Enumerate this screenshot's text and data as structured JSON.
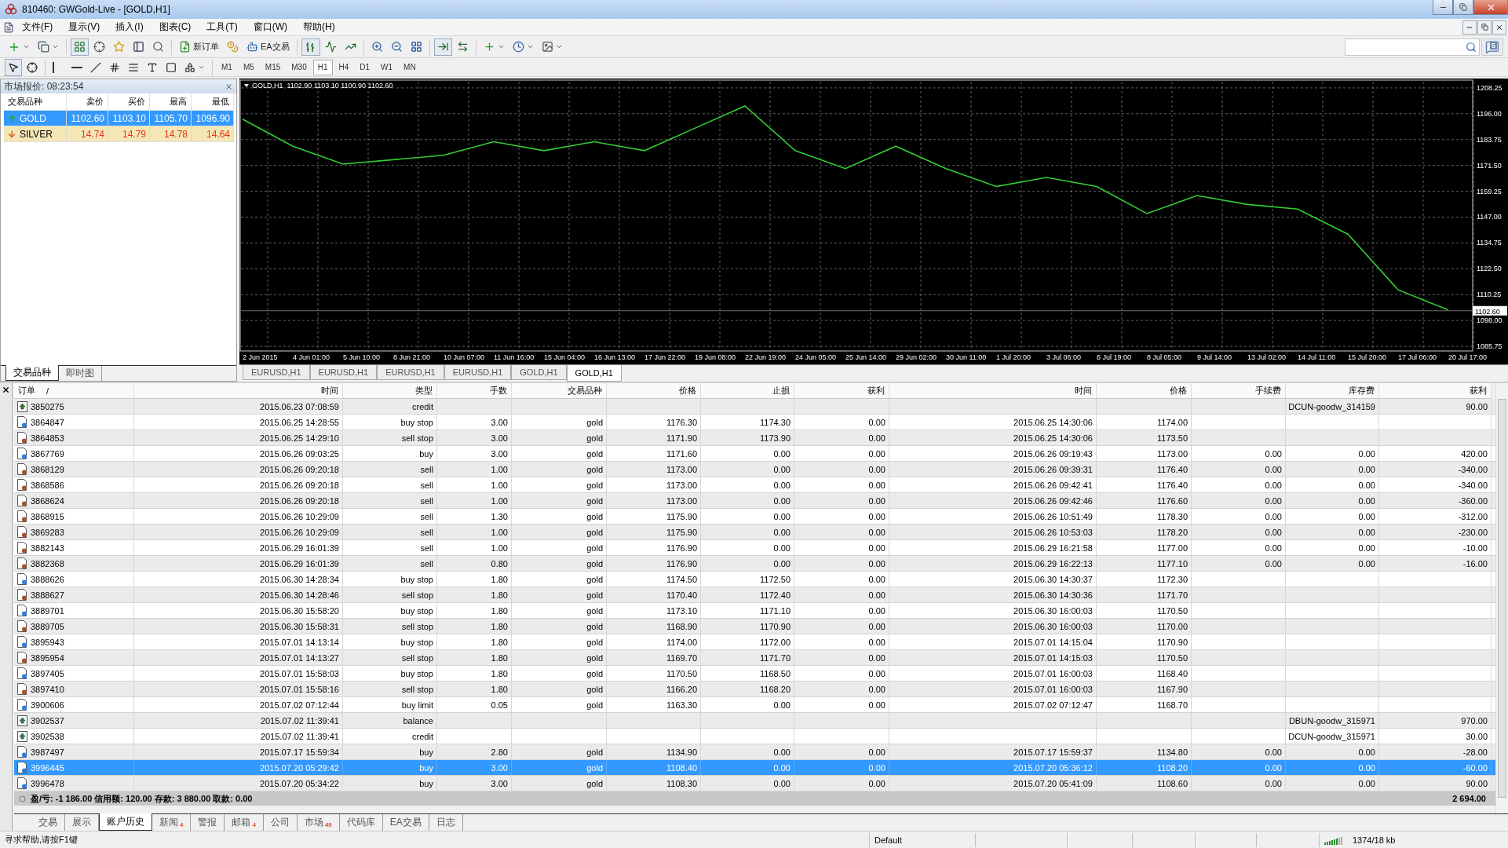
{
  "window": {
    "title": "810460: GWGold-Live - [GOLD,H1]"
  },
  "menu": [
    "文件(F)",
    "显示(V)",
    "插入(I)",
    "图表(C)",
    "工具(T)",
    "窗口(W)",
    "帮助(H)"
  ],
  "toolbar": {
    "buttons": [
      "新订单",
      "EA交易"
    ],
    "notifications": "5"
  },
  "timeframes": [
    {
      "label": "M1",
      "selected": false
    },
    {
      "label": "M5",
      "selected": false
    },
    {
      "label": "M15",
      "selected": false
    },
    {
      "label": "M30",
      "selected": false
    },
    {
      "label": "H1",
      "selected": true
    },
    {
      "label": "H4",
      "selected": false
    },
    {
      "label": "D1",
      "selected": false
    },
    {
      "label": "W1",
      "selected": false
    },
    {
      "label": "MN",
      "selected": false
    }
  ],
  "market_watch": {
    "title": "市场报价: 08:23:54",
    "columns": [
      "交易品种",
      "卖价",
      "买价",
      "最高",
      "最低"
    ],
    "rows": [
      {
        "symbol": "GOLD",
        "rising": true,
        "selected": true,
        "bid": "1102.60",
        "ask": "1103.10",
        "high": "1105.70",
        "low": "1096.90"
      },
      {
        "symbol": "SILVER",
        "rising": false,
        "selected": false,
        "bid": "14.74",
        "ask": "14.79",
        "high": "14.78",
        "low": "14.64"
      }
    ],
    "tabs": [
      {
        "label": "交易品种",
        "selected": true
      },
      {
        "label": "即时图",
        "selected": false
      }
    ]
  },
  "chart": {
    "header": "GOLD,H1  1102.90 1103.10 1100.90 1102.60",
    "chart_data": {
      "type": "line",
      "x": [
        "2 Jun 2015",
        "4 Jun 01:00",
        "5 Jun 10:00",
        "8 Jun 21:00",
        "10 Jun 07:00",
        "11 Jun 16:00",
        "15 Jun 04:00",
        "16 Jun 13:00",
        "17 Jun 22:00",
        "19 Jun 08:00",
        "22 Jun 19:00",
        "24 Jun 05:00",
        "25 Jun 14:00",
        "29 Jun 02:00",
        "30 Jun 11:00",
        "1 Jul 20:00",
        "3 Jul 06:00",
        "6 Jul 19:00",
        "8 Jul 05:00",
        "9 Jul 14:00",
        "13 Jul 02:00",
        "14 Jul 11:00",
        "15 Jul 20:00",
        "17 Jul 06:00",
        "20 Jul 17:00"
      ],
      "series": [
        {
          "color": "#33cc33",
          "values": [
            1193.4,
            1180.6,
            1172.1,
            1174.2,
            1176.3,
            1182.7,
            1178.5,
            1182.7,
            1178.5,
            1189.1,
            1199.7,
            1178.5,
            1170.0,
            1180.6,
            1170.0,
            1161.5,
            1165.8,
            1161.5,
            1148.7,
            1157.2,
            1153.0,
            1150.8,
            1138.9,
            1112.5,
            1103.0
          ]
        }
      ],
      "yticks": [
        {
          "value": 1208.25,
          "label": "1208.25"
        },
        {
          "value": 1196,
          "label": "1196.00"
        },
        {
          "value": 1183.75,
          "label": "1183.75"
        },
        {
          "value": 1171.5,
          "label": "1171.50"
        },
        {
          "value": 1159.25,
          "label": "1159.25"
        },
        {
          "value": 1147,
          "label": "1147.00"
        },
        {
          "value": 1134.75,
          "label": "1134.75"
        },
        {
          "value": 1122.5,
          "label": "1122.50"
        },
        {
          "value": 1110.25,
          "label": "1110.25"
        },
        {
          "value": 1098,
          "label": "1098.00"
        },
        {
          "value": 1085.75,
          "label": "1085.75"
        }
      ],
      "ylim": [
        1083.9,
        1211.2
      ],
      "grid": true,
      "ref_lines": [
        {
          "axis": "y",
          "value": 1102.6,
          "label": "1102.60"
        }
      ]
    },
    "tabs": [
      {
        "label": "EURUSD,H1",
        "selected": false
      },
      {
        "label": "EURUSD,H1",
        "selected": false
      },
      {
        "label": "EURUSD,H1",
        "selected": false
      },
      {
        "label": "EURUSD,H1",
        "selected": false
      },
      {
        "label": "GOLD,H1",
        "selected": false
      },
      {
        "label": "GOLD,H1",
        "selected": true
      }
    ]
  },
  "history": {
    "columns": [
      "订单",
      "时间",
      "类型",
      "手数",
      "交易品种",
      "价格",
      "止损",
      "获利",
      "时间",
      "价格",
      "手续费",
      "库存费",
      "获利"
    ],
    "sort_mark": "/",
    "rows": [
      {
        "kind": "deposit",
        "selected": false,
        "order": "3850275",
        "time": "2015.06.23 07:08:59",
        "type": "credit",
        "comment": "DCUN-goodw_314159",
        "profit": "90.00"
      },
      {
        "kind": "buy",
        "selected": false,
        "order": "3864847",
        "time": "2015.06.25 14:28:55",
        "type": "buy stop",
        "lots": "3.00",
        "symbol": "gold",
        "price": "1176.30",
        "sl": "1174.30",
        "tp": "0.00",
        "close_time": "2015.06.25 14:30:06",
        "close_price": "1174.00"
      },
      {
        "kind": "sell",
        "selected": false,
        "order": "3864853",
        "time": "2015.06.25 14:29:10",
        "type": "sell stop",
        "lots": "3.00",
        "symbol": "gold",
        "price": "1171.90",
        "sl": "1173.90",
        "tp": "0.00",
        "close_time": "2015.06.25 14:30:06",
        "close_price": "1173.50"
      },
      {
        "kind": "buy",
        "selected": false,
        "order": "3867769",
        "time": "2015.06.26 09:03:25",
        "type": "buy",
        "lots": "3.00",
        "symbol": "gold",
        "price": "1171.60",
        "sl": "0.00",
        "tp": "0.00",
        "close_time": "2015.06.26 09:19:43",
        "close_price": "1173.00",
        "commission": "0.00",
        "swap": "0.00",
        "profit": "420.00"
      },
      {
        "kind": "sell",
        "selected": false,
        "order": "3868129",
        "time": "2015.06.26 09:20:18",
        "type": "sell",
        "lots": "1.00",
        "symbol": "gold",
        "price": "1173.00",
        "sl": "0.00",
        "tp": "0.00",
        "close_time": "2015.06.26 09:39:31",
        "close_price": "1176.40",
        "commission": "0.00",
        "swap": "0.00",
        "profit": "-340.00"
      },
      {
        "kind": "sell",
        "selected": false,
        "order": "3868586",
        "time": "2015.06.26 09:20:18",
        "type": "sell",
        "lots": "1.00",
        "symbol": "gold",
        "price": "1173.00",
        "sl": "0.00",
        "tp": "0.00",
        "close_time": "2015.06.26 09:42:41",
        "close_price": "1176.40",
        "commission": "0.00",
        "swap": "0.00",
        "profit": "-340.00"
      },
      {
        "kind": "sell",
        "selected": false,
        "order": "3868624",
        "time": "2015.06.26 09:20:18",
        "type": "sell",
        "lots": "1.00",
        "symbol": "gold",
        "price": "1173.00",
        "sl": "0.00",
        "tp": "0.00",
        "close_time": "2015.06.26 09:42:46",
        "close_price": "1176.60",
        "commission": "0.00",
        "swap": "0.00",
        "profit": "-360.00"
      },
      {
        "kind": "sell",
        "selected": false,
        "order": "3868915",
        "time": "2015.06.26 10:29:09",
        "type": "sell",
        "lots": "1.30",
        "symbol": "gold",
        "price": "1175.90",
        "sl": "0.00",
        "tp": "0.00",
        "close_time": "2015.06.26 10:51:49",
        "close_price": "1178.30",
        "commission": "0.00",
        "swap": "0.00",
        "profit": "-312.00"
      },
      {
        "kind": "sell",
        "selected": false,
        "order": "3869283",
        "time": "2015.06.26 10:29:09",
        "type": "sell",
        "lots": "1.00",
        "symbol": "gold",
        "price": "1175.90",
        "sl": "0.00",
        "tp": "0.00",
        "close_time": "2015.06.26 10:53:03",
        "close_price": "1178.20",
        "commission": "0.00",
        "swap": "0.00",
        "profit": "-230.00"
      },
      {
        "kind": "sell",
        "selected": false,
        "order": "3882143",
        "time": "2015.06.29 16:01:39",
        "type": "sell",
        "lots": "1.00",
        "symbol": "gold",
        "price": "1176.90",
        "sl": "0.00",
        "tp": "0.00",
        "close_time": "2015.06.29 16:21:58",
        "close_price": "1177.00",
        "commission": "0.00",
        "swap": "0.00",
        "profit": "-10.00"
      },
      {
        "kind": "sell",
        "selected": false,
        "order": "3882368",
        "time": "2015.06.29 16:01:39",
        "type": "sell",
        "lots": "0.80",
        "symbol": "gold",
        "price": "1176.90",
        "sl": "0.00",
        "tp": "0.00",
        "close_time": "2015.06.29 16:22:13",
        "close_price": "1177.10",
        "commission": "0.00",
        "swap": "0.00",
        "profit": "-16.00"
      },
      {
        "kind": "buy",
        "selected": false,
        "order": "3888626",
        "time": "2015.06.30 14:28:34",
        "type": "buy stop",
        "lots": "1.80",
        "symbol": "gold",
        "price": "1174.50",
        "sl": "1172.50",
        "tp": "0.00",
        "close_time": "2015.06.30 14:30:37",
        "close_price": "1172.30"
      },
      {
        "kind": "sell",
        "selected": false,
        "order": "3888627",
        "time": "2015.06.30 14:28:46",
        "type": "sell stop",
        "lots": "1.80",
        "symbol": "gold",
        "price": "1170.40",
        "sl": "1172.40",
        "tp": "0.00",
        "close_time": "2015.06.30 14:30:36",
        "close_price": "1171.70"
      },
      {
        "kind": "buy",
        "selected": false,
        "order": "3889701",
        "time": "2015.06.30 15:58:20",
        "type": "buy stop",
        "lots": "1.80",
        "symbol": "gold",
        "price": "1173.10",
        "sl": "1171.10",
        "tp": "0.00",
        "close_time": "2015.06.30 16:00:03",
        "close_price": "1170.50"
      },
      {
        "kind": "sell",
        "selected": false,
        "order": "3889705",
        "time": "2015.06.30 15:58:31",
        "type": "sell stop",
        "lots": "1.80",
        "symbol": "gold",
        "price": "1168.90",
        "sl": "1170.90",
        "tp": "0.00",
        "close_time": "2015.06.30 16:00:03",
        "close_price": "1170.00"
      },
      {
        "kind": "buy",
        "selected": false,
        "order": "3895943",
        "time": "2015.07.01 14:13:14",
        "type": "buy stop",
        "lots": "1.80",
        "symbol": "gold",
        "price": "1174.00",
        "sl": "1172.00",
        "tp": "0.00",
        "close_time": "2015.07.01 14:15:04",
        "close_price": "1170.90"
      },
      {
        "kind": "sell",
        "selected": false,
        "order": "3895954",
        "time": "2015.07.01 14:13:27",
        "type": "sell stop",
        "lots": "1.80",
        "symbol": "gold",
        "price": "1169.70",
        "sl": "1171.70",
        "tp": "0.00",
        "close_time": "2015.07.01 14:15:03",
        "close_price": "1170.50"
      },
      {
        "kind": "buy",
        "selected": false,
        "order": "3897405",
        "time": "2015.07.01 15:58:03",
        "type": "buy stop",
        "lots": "1.80",
        "symbol": "gold",
        "price": "1170.50",
        "sl": "1168.50",
        "tp": "0.00",
        "close_time": "2015.07.01 16:00:03",
        "close_price": "1168.40"
      },
      {
        "kind": "sell",
        "selected": false,
        "order": "3897410",
        "time": "2015.07.01 15:58:16",
        "type": "sell stop",
        "lots": "1.80",
        "symbol": "gold",
        "price": "1166.20",
        "sl": "1168.20",
        "tp": "0.00",
        "close_time": "2015.07.01 16:00:03",
        "close_price": "1167.90"
      },
      {
        "kind": "buy",
        "selected": false,
        "order": "3900606",
        "time": "2015.07.02 07:12:44",
        "type": "buy limit",
        "lots": "0.05",
        "symbol": "gold",
        "price": "1163.30",
        "sl": "0.00",
        "tp": "0.00",
        "close_time": "2015.07.02 07:12:47",
        "close_price": "1168.70"
      },
      {
        "kind": "deposit",
        "selected": false,
        "order": "3902537",
        "time": "2015.07.02 11:39:41",
        "type": "balance",
        "comment": "DBUN-goodw_315971",
        "profit": "970.00"
      },
      {
        "kind": "deposit",
        "selected": false,
        "order": "3902538",
        "time": "2015.07.02 11:39:41",
        "type": "credit",
        "comment": "DCUN-goodw_315971",
        "profit": "30.00"
      },
      {
        "kind": "buy",
        "selected": false,
        "order": "3987497",
        "time": "2015.07.17 15:59:34",
        "type": "buy",
        "lots": "2.80",
        "symbol": "gold",
        "price": "1134.90",
        "sl": "0.00",
        "tp": "0.00",
        "close_time": "2015.07.17 15:59:37",
        "close_price": "1134.80",
        "commission": "0.00",
        "swap": "0.00",
        "profit": "-28.00"
      },
      {
        "kind": "buy",
        "selected": true,
        "order": "3996445",
        "time": "2015.07.20 05:29:42",
        "type": "buy",
        "lots": "3.00",
        "symbol": "gold",
        "price": "1108.40",
        "sl": "0.00",
        "tp": "0.00",
        "close_time": "2015.07.20 05:36:12",
        "close_price": "1108.20",
        "commission": "0.00",
        "swap": "0.00",
        "profit": "-60.00"
      },
      {
        "kind": "buy",
        "selected": false,
        "order": "3996478",
        "time": "2015.07.20 05:34:22",
        "type": "buy",
        "lots": "3.00",
        "symbol": "gold",
        "price": "1108.30",
        "sl": "0.00",
        "tp": "0.00",
        "close_time": "2015.07.20 05:41:09",
        "close_price": "1108.60",
        "commission": "0.00",
        "swap": "0.00",
        "profit": "90.00"
      }
    ],
    "summary": "盈/亏: -1 186.00  信用额: 120.00  存款: 3 880.00  取款: 0.00",
    "total": "2 694.00"
  },
  "terminal_tabs": [
    {
      "label": "交易",
      "selected": false
    },
    {
      "label": "展示",
      "selected": false
    },
    {
      "label": "账户历史",
      "selected": true
    },
    {
      "label": "新闻",
      "badge": "4",
      "selected": false
    },
    {
      "label": "警报",
      "selected": false
    },
    {
      "label": "邮箱",
      "badge": "4",
      "selected": false
    },
    {
      "label": "公司",
      "selected": false
    },
    {
      "label": "市场",
      "badge": "49",
      "selected": false
    },
    {
      "label": "代码库",
      "selected": false
    },
    {
      "label": "EA交易",
      "selected": false
    },
    {
      "label": "日志",
      "selected": false
    }
  ],
  "status_bar": {
    "help": "寻求帮助,请按F1键",
    "profile": "Default",
    "traffic": "1374/18 kb"
  }
}
